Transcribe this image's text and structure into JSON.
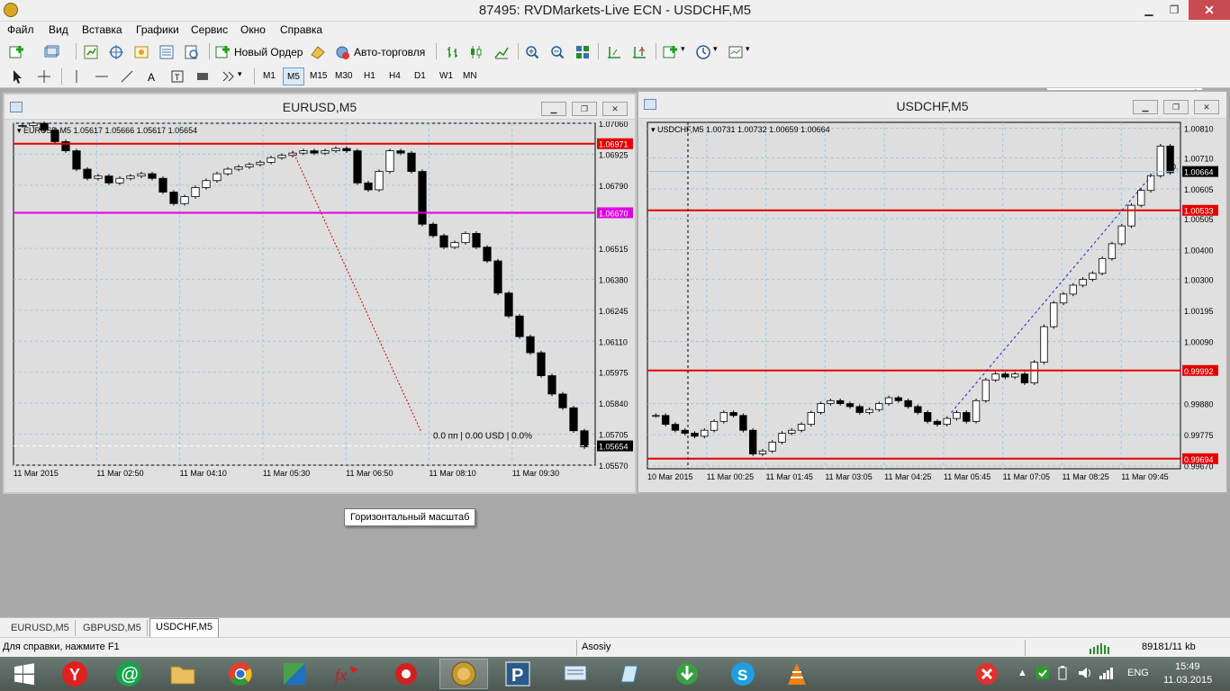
{
  "window": {
    "title": "87495: RVDMarkets-Live ECN - USDCHF,M5",
    "minimize": "▁",
    "maximize": "❐",
    "close": "✕"
  },
  "menu": [
    "Файл",
    "Вид",
    "Вставка",
    "Графики",
    "Сервис",
    "Окно",
    "Справка"
  ],
  "toolbar": {
    "new_order": "Новый Ордер",
    "autotrade": "Авто-торговля"
  },
  "timeframes": [
    "M1",
    "M5",
    "M15",
    "M30",
    "H1",
    "H4",
    "D1",
    "W1",
    "MN"
  ],
  "active_timeframe": "M5",
  "search": {
    "placeholder": ""
  },
  "charts": [
    {
      "title": "EURUSD,M5",
      "info": "EURUSD,M5  1.05617 1.05666 1.05617 1.05654",
      "price_ticks": [
        "1.07060",
        "1.06925",
        "1.06790",
        "1.06515",
        "1.06380",
        "1.06245",
        "1.06110",
        "1.05975",
        "1.05840",
        "1.05705",
        "1.05570"
      ],
      "ylim": [
        1.0557,
        1.0706
      ],
      "time_ticks": [
        "11 Mar 2015",
        "11 Mar 02:50",
        "11 Mar 04:10",
        "11 Mar 05:30",
        "11 Mar 06:50",
        "11 Mar 08:10",
        "11 Mar 09:30"
      ],
      "red_line": {
        "label": "1.06971",
        "price": 1.06971,
        "color": "#e00000"
      },
      "magenta_line": {
        "label": "1.06670",
        "price": 1.0667,
        "color": "#e000e0"
      },
      "last_label": "1.05654",
      "profit_text": "0.0 пп | 0.00 USD | 0.0%",
      "close_path": [
        1.0705,
        1.0706,
        1.0703,
        1.0698,
        1.0694,
        1.0686,
        1.0682,
        1.0683,
        1.068,
        1.0682,
        1.0683,
        1.0684,
        1.0682,
        1.0676,
        1.0671,
        1.0674,
        1.0678,
        1.0681,
        1.0684,
        1.0686,
        1.0687,
        1.0688,
        1.0689,
        1.0691,
        1.0692,
        1.0693,
        1.0694,
        1.0693,
        1.0694,
        1.0695,
        1.0694,
        1.068,
        1.0677,
        1.0685,
        1.0694,
        1.0693,
        1.0685,
        1.0662,
        1.0657,
        1.0652,
        1.0654,
        1.0658,
        1.0652,
        1.0646,
        1.0632,
        1.0622,
        1.0613,
        1.0606,
        1.0596,
        1.0588,
        1.0582,
        1.0572,
        1.0565
      ]
    },
    {
      "title": "USDCHF,M5",
      "info": "USDCHF,M5  1.00731 1.00732 1.00659 1.00664",
      "price_ticks": [
        "1.00810",
        "1.00710",
        "1.00605",
        "1.00505",
        "1.00400",
        "1.00300",
        "1.00195",
        "1.00090",
        "0.99880",
        "0.99775",
        "0.99670"
      ],
      "ylim": [
        0.9966,
        1.0083
      ],
      "time_ticks": [
        "10 Mar 2015",
        "11 Mar 00:25",
        "11 Mar 01:45",
        "11 Mar 03:05",
        "11 Mar 04:25",
        "11 Mar 05:45",
        "11 Mar 07:05",
        "11 Mar 08:25",
        "11 Mar 09:45"
      ],
      "red_lines": [
        {
          "label": "1.00533",
          "price": 1.00533
        },
        {
          "label": "0.99992",
          "price": 0.99992
        },
        {
          "label": "0.99694",
          "price": 0.99694
        }
      ],
      "current_price": {
        "label": "1.00664",
        "price": 1.00664
      },
      "side_text": "0.",
      "close_path": [
        0.9984,
        0.9981,
        0.9979,
        0.9978,
        0.9977,
        0.9979,
        0.9982,
        0.9985,
        0.9984,
        0.9979,
        0.9971,
        0.9972,
        0.9975,
        0.9978,
        0.9979,
        0.9981,
        0.9985,
        0.9988,
        0.9989,
        0.9988,
        0.9987,
        0.9985,
        0.9986,
        0.9988,
        0.999,
        0.9989,
        0.9987,
        0.9985,
        0.9982,
        0.9981,
        0.9983,
        0.9985,
        0.9982,
        0.9989,
        0.9996,
        0.9998,
        0.9997,
        0.9998,
        0.9995,
        1.0002,
        1.0014,
        1.0022,
        1.0025,
        1.0028,
        1.003,
        1.0032,
        1.0037,
        1.0042,
        1.0048,
        1.0055,
        1.006,
        1.0065,
        1.0075,
        1.0066
      ]
    }
  ],
  "tooltip": "Горизонтальный масштаб",
  "tabs": [
    "EURUSD,M5",
    "GBPUSD,M5",
    "USDCHF,M5"
  ],
  "status": {
    "help": "Для справки, нажмите F1",
    "profile": "Asosiy",
    "traffic": "89181/11 kb"
  },
  "taskbar": {
    "lang": "ENG",
    "time": "15:49",
    "date": "11.03.2015"
  }
}
